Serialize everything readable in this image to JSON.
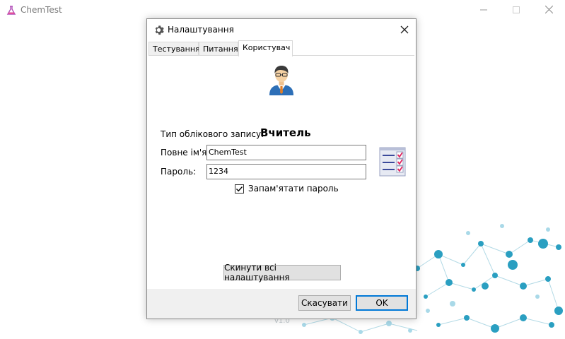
{
  "app": {
    "title": "ChemTest",
    "version": "v1.0"
  },
  "dialog": {
    "title": "Налаштування",
    "tabs": [
      {
        "label": "Тестування",
        "active": false
      },
      {
        "label": "Питання",
        "active": false
      },
      {
        "label": "Користувач",
        "active": true
      }
    ],
    "user": {
      "account_type_label": "Тип облікового запису:",
      "account_type_value": "Вчитель",
      "full_name_label": "Повне ім'я:",
      "full_name_value": "ChemTest",
      "password_label": "Пароль:",
      "password_value": "1234",
      "remember_label": "Запам'ятати пароль",
      "remember_checked": true
    },
    "reset_label": "Скинути всі налаштування",
    "cancel_label": "Скасувати",
    "ok_label": "OK"
  },
  "colors": {
    "accent": "#0078d7",
    "molecule": "#2a9fc1"
  },
  "icons": [
    "flask-icon",
    "gear-icon",
    "close-icon",
    "minimize-icon",
    "maximize-icon",
    "user-avatar-icon",
    "checklist-icon",
    "checkmark-icon"
  ]
}
